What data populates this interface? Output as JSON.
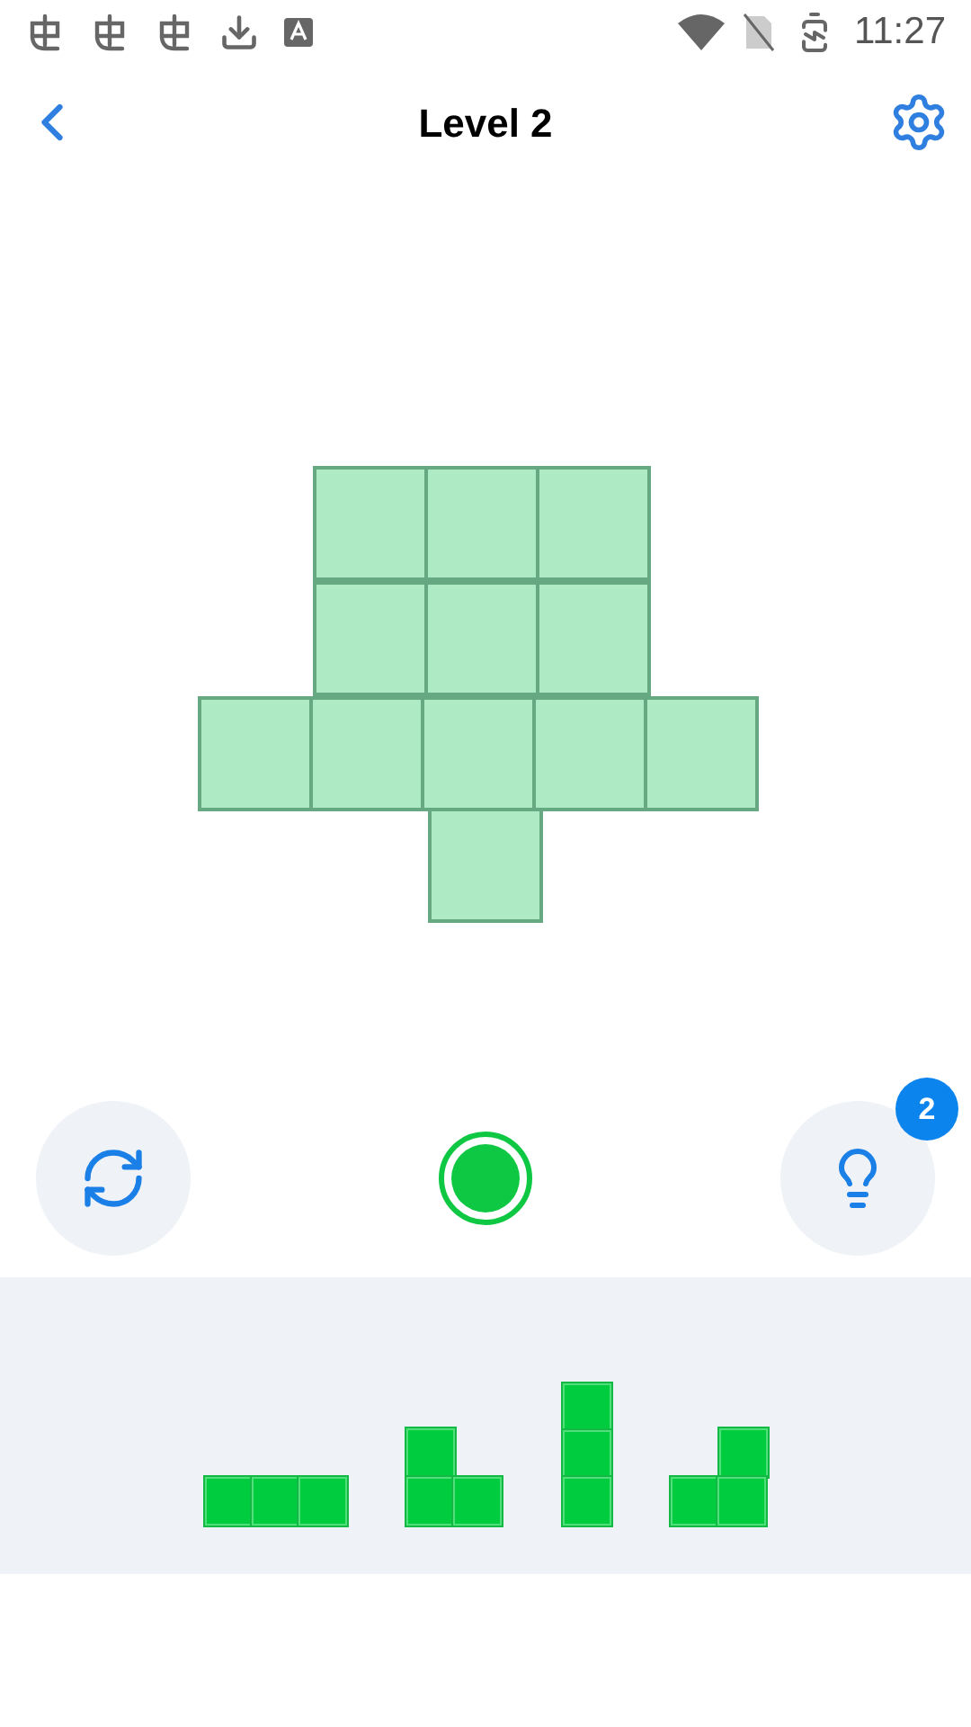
{
  "status_bar": {
    "time": "11:27"
  },
  "header": {
    "title": "Level 2"
  },
  "board": {
    "rows": [
      [
        false,
        true,
        true,
        true,
        false
      ],
      [
        false,
        true,
        true,
        true,
        false
      ],
      [
        true,
        true,
        true,
        true,
        true
      ],
      [
        false,
        false,
        true,
        false,
        false
      ]
    ]
  },
  "hint": {
    "count": "2"
  },
  "pieces": [
    {
      "rows": [
        [
          true,
          true,
          true
        ]
      ]
    },
    {
      "rows": [
        [
          true,
          false
        ],
        [
          true,
          true
        ]
      ]
    },
    {
      "rows": [
        [
          true
        ],
        [
          true
        ],
        [
          true
        ]
      ]
    },
    {
      "rows": [
        [
          false,
          true
        ],
        [
          true,
          true
        ]
      ]
    }
  ]
}
